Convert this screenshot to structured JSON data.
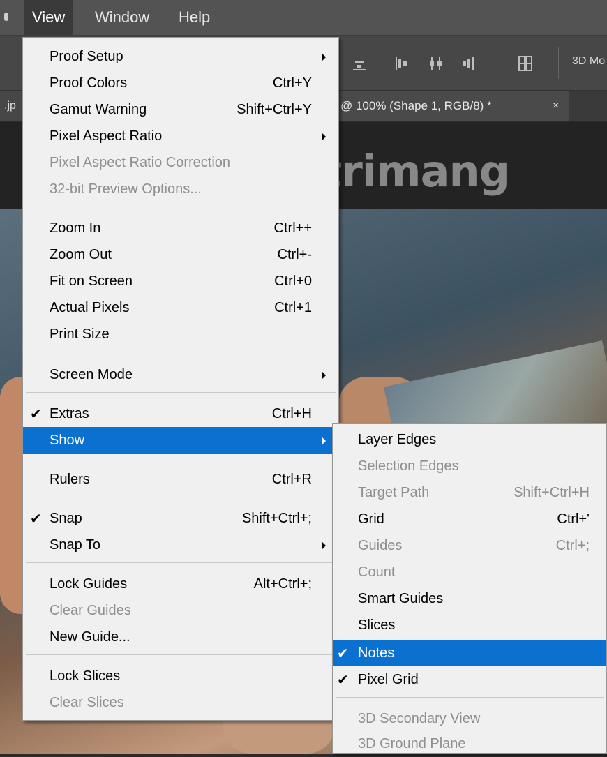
{
  "menubar": {
    "items": [
      {
        "label": "View",
        "active": true
      },
      {
        "label": "Window",
        "active": false
      },
      {
        "label": "Help",
        "active": false
      }
    ]
  },
  "options_bar": {
    "mode_label": "3D Mo"
  },
  "doc_tabs": {
    "left_tab": ".jp",
    "active_tab": "@ 100% (Shape 1, RGB/8) *",
    "close": "×"
  },
  "watermark": {
    "text": "uantrimang"
  },
  "view_menu": {
    "items": [
      {
        "label": "Proof Setup",
        "shortcut": "",
        "submenu": true,
        "disabled": false,
        "checked": false
      },
      {
        "label": "Proof Colors",
        "shortcut": "Ctrl+Y",
        "submenu": false,
        "disabled": false,
        "checked": false
      },
      {
        "label": "Gamut Warning",
        "shortcut": "Shift+Ctrl+Y",
        "submenu": false,
        "disabled": false,
        "checked": false
      },
      {
        "label": "Pixel Aspect Ratio",
        "shortcut": "",
        "submenu": true,
        "disabled": false,
        "checked": false
      },
      {
        "label": "Pixel Aspect Ratio Correction",
        "shortcut": "",
        "submenu": false,
        "disabled": true,
        "checked": false
      },
      {
        "label": "32-bit Preview Options...",
        "shortcut": "",
        "submenu": false,
        "disabled": true,
        "checked": false
      },
      {
        "label": "Zoom In",
        "shortcut": "Ctrl++",
        "submenu": false,
        "disabled": false,
        "checked": false
      },
      {
        "label": "Zoom Out",
        "shortcut": "Ctrl+-",
        "submenu": false,
        "disabled": false,
        "checked": false
      },
      {
        "label": "Fit on Screen",
        "shortcut": "Ctrl+0",
        "submenu": false,
        "disabled": false,
        "checked": false
      },
      {
        "label": "Actual Pixels",
        "shortcut": "Ctrl+1",
        "submenu": false,
        "disabled": false,
        "checked": false
      },
      {
        "label": "Print Size",
        "shortcut": "",
        "submenu": false,
        "disabled": false,
        "checked": false
      },
      {
        "label": "Screen Mode",
        "shortcut": "",
        "submenu": true,
        "disabled": false,
        "checked": false
      },
      {
        "label": "Extras",
        "shortcut": "Ctrl+H",
        "submenu": false,
        "disabled": false,
        "checked": true
      },
      {
        "label": "Show",
        "shortcut": "",
        "submenu": true,
        "disabled": false,
        "checked": false,
        "highlighted": true
      },
      {
        "label": "Rulers",
        "shortcut": "Ctrl+R",
        "submenu": false,
        "disabled": false,
        "checked": false
      },
      {
        "label": "Snap",
        "shortcut": "Shift+Ctrl+;",
        "submenu": false,
        "disabled": false,
        "checked": true
      },
      {
        "label": "Snap To",
        "shortcut": "",
        "submenu": true,
        "disabled": false,
        "checked": false
      },
      {
        "label": "Lock Guides",
        "shortcut": "Alt+Ctrl+;",
        "submenu": false,
        "disabled": false,
        "checked": false
      },
      {
        "label": "Clear Guides",
        "shortcut": "",
        "submenu": false,
        "disabled": true,
        "checked": false
      },
      {
        "label": "New Guide...",
        "shortcut": "",
        "submenu": false,
        "disabled": false,
        "checked": false
      },
      {
        "label": "Lock Slices",
        "shortcut": "",
        "submenu": false,
        "disabled": false,
        "checked": false
      },
      {
        "label": "Clear Slices",
        "shortcut": "",
        "submenu": false,
        "disabled": true,
        "checked": false
      }
    ]
  },
  "show_submenu": {
    "items": [
      {
        "label": "Layer Edges",
        "shortcut": "",
        "disabled": false,
        "checked": false
      },
      {
        "label": "Selection Edges",
        "shortcut": "",
        "disabled": true,
        "checked": false
      },
      {
        "label": "Target Path",
        "shortcut": "Shift+Ctrl+H",
        "disabled": true,
        "checked": false
      },
      {
        "label": "Grid",
        "shortcut": "Ctrl+'",
        "disabled": false,
        "checked": false
      },
      {
        "label": "Guides",
        "shortcut": "Ctrl+;",
        "disabled": true,
        "checked": false
      },
      {
        "label": "Count",
        "shortcut": "",
        "disabled": true,
        "checked": false
      },
      {
        "label": "Smart Guides",
        "shortcut": "",
        "disabled": false,
        "checked": false
      },
      {
        "label": "Slices",
        "shortcut": "",
        "disabled": false,
        "checked": false
      },
      {
        "label": "Notes",
        "shortcut": "",
        "disabled": false,
        "checked": true,
        "highlighted": true
      },
      {
        "label": "Pixel Grid",
        "shortcut": "",
        "disabled": false,
        "checked": true
      },
      {
        "label": "3D Secondary View",
        "shortcut": "",
        "disabled": true,
        "checked": false
      },
      {
        "label": "3D Ground Plane",
        "shortcut": "",
        "disabled": true,
        "checked": false
      }
    ]
  },
  "colors": {
    "highlight": "#0a71d0",
    "menu_bg": "#f0f0f0",
    "disabled_text": "#8f8f8f"
  }
}
